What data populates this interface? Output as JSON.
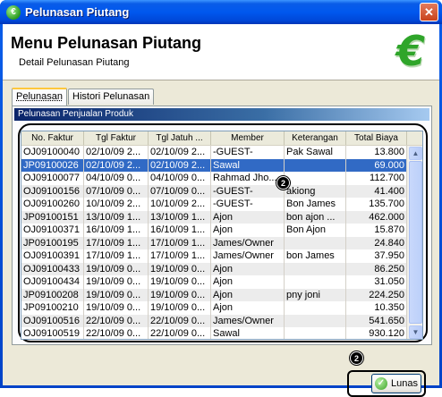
{
  "window": {
    "title": "Pelunasan Piutang",
    "close_glyph": "✕"
  },
  "header": {
    "title": "Menu Pelunasan Piutang",
    "subtitle": "Detail Pelunasan Piutang",
    "logo_icon": "euro-icon",
    "logo_glyph": "€"
  },
  "tabs": [
    {
      "label": "Pelunasan",
      "active": true
    },
    {
      "label": "Histori Pelunasan",
      "active": false
    }
  ],
  "group": {
    "title": "Pelunasan Penjualan Produk"
  },
  "table": {
    "columns": [
      "No. Faktur",
      "Tgl Faktur",
      "Tgl Jatuh ...",
      "Member",
      "Keterangan",
      "Total Biaya"
    ],
    "rows": [
      [
        "OJ09100040",
        "02/10/09 2...",
        "02/10/09 2...",
        "-GUEST-",
        "Pak Sawal",
        "13.800"
      ],
      [
        "JP09100026",
        "02/10/09 2...",
        "02/10/09 2...",
        "Sawal",
        "",
        "69.000"
      ],
      [
        "OJ09100077",
        "04/10/09 0...",
        "04/10/09 0...",
        "Rahmad Jho...",
        "",
        "112.700"
      ],
      [
        "OJ09100156",
        "07/10/09 0...",
        "07/10/09 0...",
        "-GUEST-",
        "akiong",
        "41.400"
      ],
      [
        "OJ09100260",
        "10/10/09 2...",
        "10/10/09 2...",
        "-GUEST-",
        "Bon James",
        "135.700"
      ],
      [
        "JP09100151",
        "13/10/09 1...",
        "13/10/09 1...",
        "Ajon",
        "bon ajon ...",
        "462.000"
      ],
      [
        "OJ09100371",
        "16/10/09 1...",
        "16/10/09 1...",
        "Ajon",
        "Bon Ajon",
        "15.870"
      ],
      [
        "JP09100195",
        "17/10/09 1...",
        "17/10/09 1...",
        "James/Owner",
        "",
        "24.840"
      ],
      [
        "OJ09100391",
        "17/10/09 1...",
        "17/10/09 1...",
        "James/Owner",
        "bon James",
        "37.950"
      ],
      [
        "OJ09100433",
        "19/10/09 0...",
        "19/10/09 0...",
        "Ajon",
        "",
        "86.250"
      ],
      [
        "OJ09100434",
        "19/10/09 0...",
        "19/10/09 0...",
        "Ajon",
        "",
        "31.050"
      ],
      [
        "JP09100208",
        "19/10/09 0...",
        "19/10/09 0...",
        "Ajon",
        "pny joni",
        "224.250"
      ],
      [
        "JP09100210",
        "19/10/09 0...",
        "19/10/09 0...",
        "Ajon",
        "",
        "10.350"
      ],
      [
        "OJ09100516",
        "22/10/09 0...",
        "22/10/09 0...",
        "James/Owner",
        "",
        "541.650"
      ],
      [
        "OJ09100519",
        "22/10/09 0...",
        "22/10/09 0...",
        "Sawal",
        "",
        "930.120"
      ]
    ],
    "selected_row": 1
  },
  "annotations": [
    "2",
    "2"
  ],
  "buttons": {
    "lunas": "Lunas",
    "lunas_icon": "check-icon"
  },
  "scrollbar": {
    "up": "▲",
    "down": "▼"
  },
  "colors": {
    "selection": "#316ac5",
    "titlebar": "#0058ee",
    "logo": "#2fa52a"
  }
}
